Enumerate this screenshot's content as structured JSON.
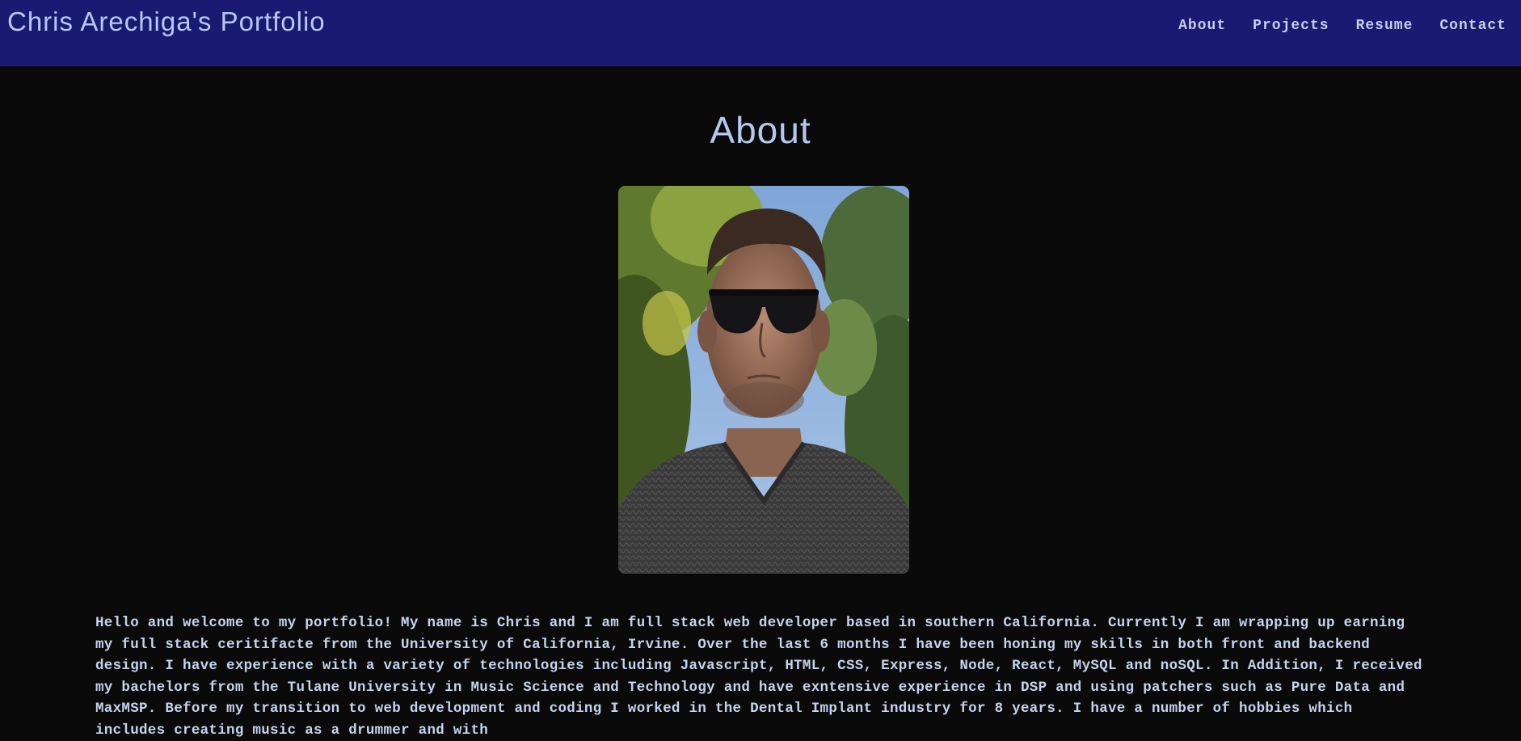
{
  "header": {
    "site_title": "Chris Arechiga's Portfolio",
    "nav": [
      {
        "label": "About"
      },
      {
        "label": "Projects"
      },
      {
        "label": "Resume"
      },
      {
        "label": "Contact"
      }
    ]
  },
  "main": {
    "heading": "About",
    "photo": {
      "alt": "Portrait of Chris Arechiga"
    },
    "bio": "Hello and welcome to my portfolio! My name is Chris and I am full stack web developer based in southern California. Currently I am wrapping up earning my full stack ceritifacte from the University of California, Irvine. Over the last 6 months I have been honing my skills in both front and backend design. I have experience with a variety of technologies including Javascript, HTML, CSS, Express, Node, React, MySQL and noSQL. In Addition, I received my bachelors from the Tulane University in Music Science and Technology and have exntensive experience in DSP and using patchers such as Pure Data and MaxMSP. Before my transition to web development and coding I worked in the Dental Implant industry for 8 years. I have a number of hobbies which includes creating music as a drummer and with"
  },
  "colors": {
    "navbar_bg": "#1b1a72",
    "page_bg": "#0a0a0b",
    "text": "#c5d4ee"
  }
}
